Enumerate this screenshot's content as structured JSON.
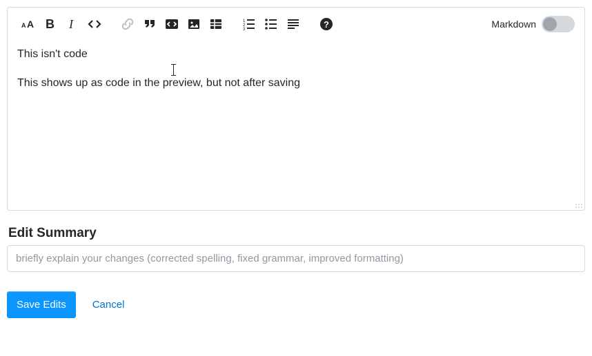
{
  "toolbar": {
    "markdown_label": "Markdown",
    "markdown_on": false
  },
  "editor": {
    "line1": "This isn't code",
    "line2": "This shows up as code in the preview, but not after saving"
  },
  "summary": {
    "label": "Edit Summary",
    "placeholder": "briefly explain your changes (corrected spelling, fixed grammar, improved formatting)",
    "value": ""
  },
  "actions": {
    "save": "Save Edits",
    "cancel": "Cancel"
  }
}
